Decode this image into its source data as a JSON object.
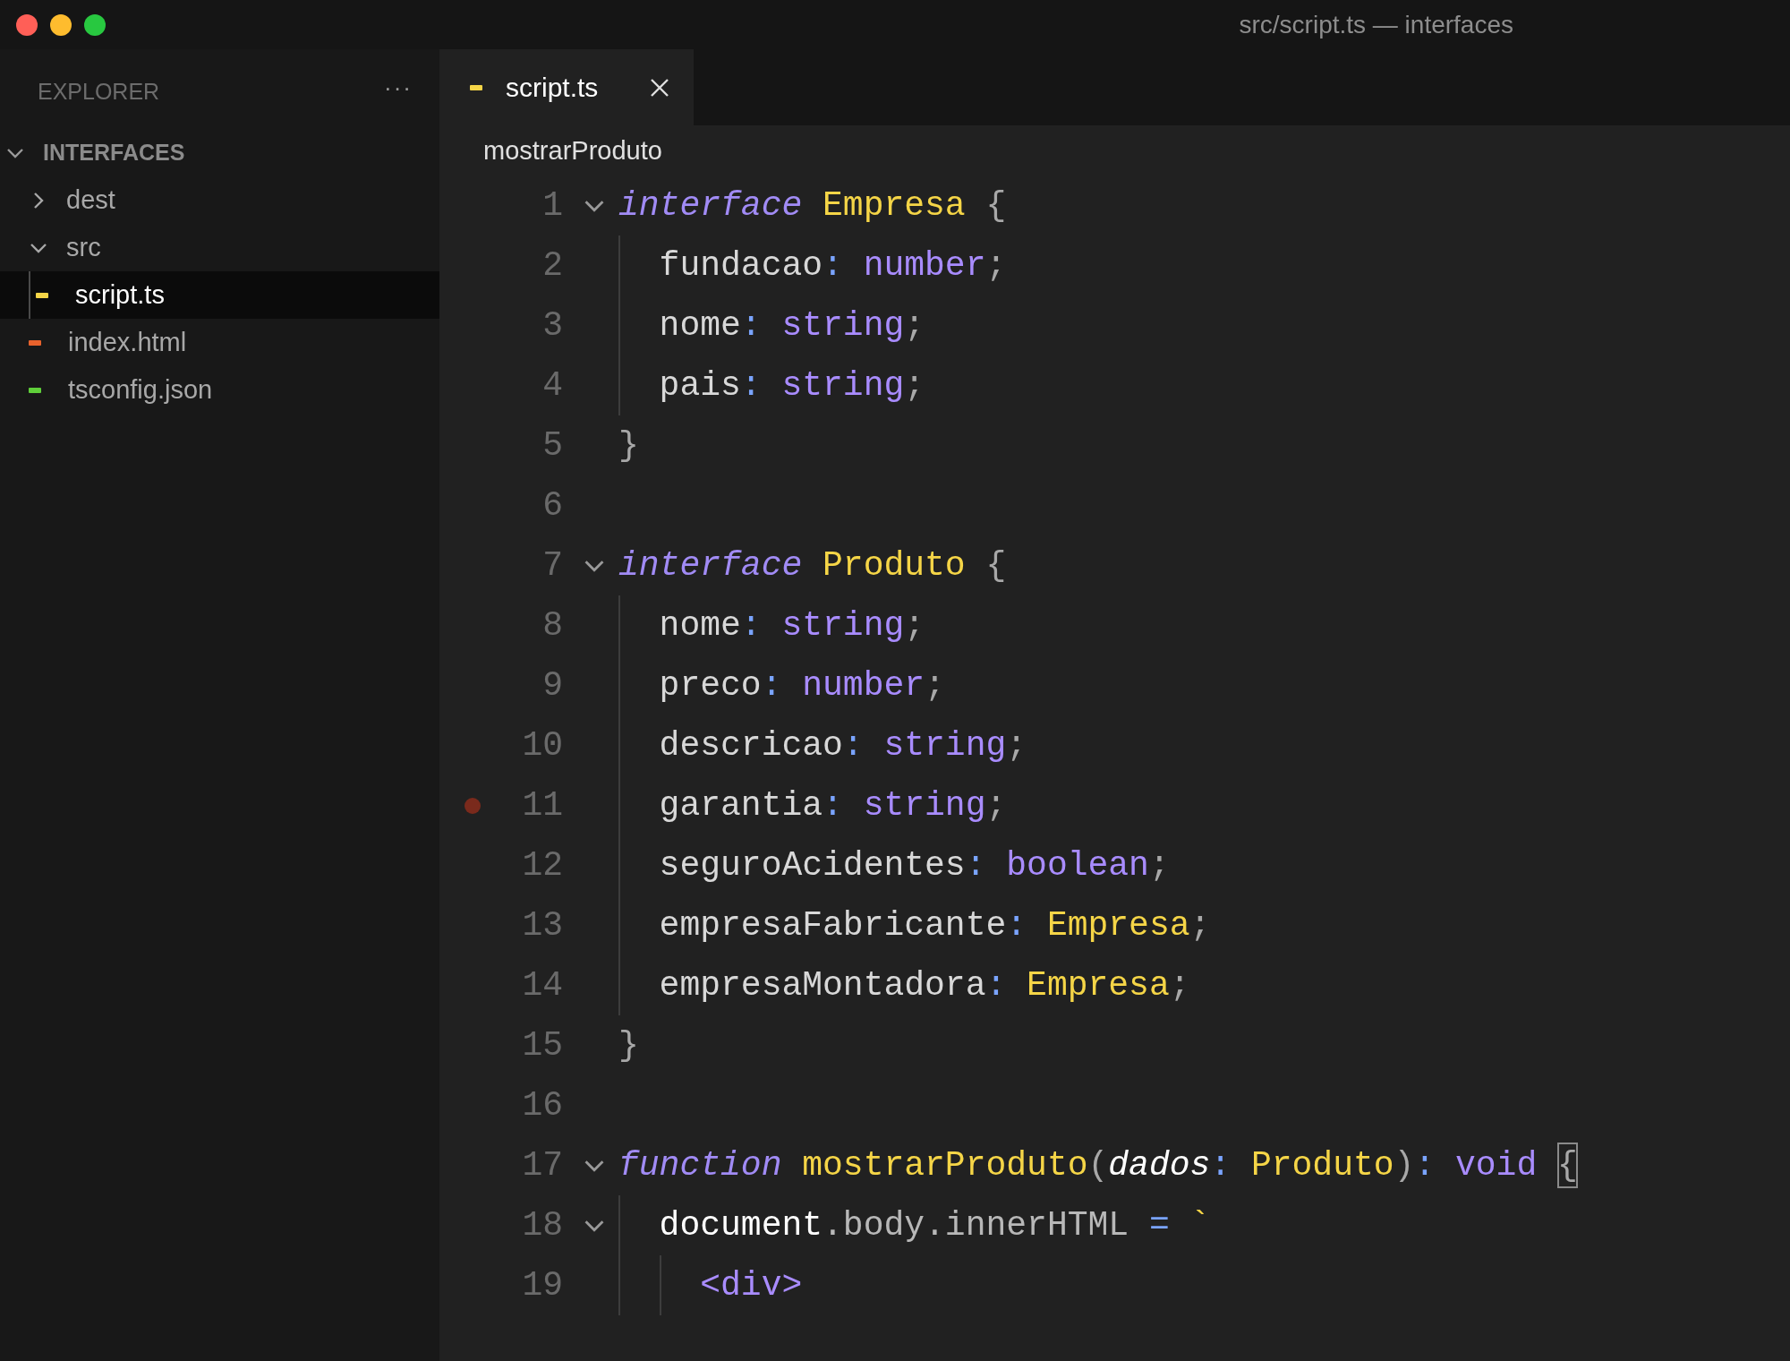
{
  "window": {
    "title": "src/script.ts — interfaces"
  },
  "sidebar": {
    "title": "EXPLORER",
    "more": "···",
    "tree": [
      {
        "label": "INTERFACES",
        "kind": "root",
        "expanded": true,
        "selected": false,
        "children": [
          {
            "label": "dest",
            "kind": "folder",
            "expanded": false,
            "selected": false
          },
          {
            "label": "src",
            "kind": "folder",
            "expanded": true,
            "selected": false,
            "children": [
              {
                "label": "script.ts",
                "kind": "file",
                "color": "#f5d547",
                "selected": true
              }
            ]
          },
          {
            "label": "index.html",
            "kind": "file",
            "color": "#e8622c",
            "selected": false
          },
          {
            "label": "tsconfig.json",
            "kind": "file",
            "color": "#5fcf3a",
            "selected": false
          }
        ]
      }
    ]
  },
  "tabs": [
    {
      "label": "script.ts",
      "color": "#f5d547",
      "selected": true
    }
  ],
  "breadcrumb": "mostrarProduto",
  "lines": [
    {
      "number": "1",
      "foldable": true,
      "breakpoint": false,
      "tokens": [
        {
          "kind": "keyword",
          "text": "interface "
        },
        {
          "kind": "type-name",
          "text": "Empresa "
        },
        {
          "kind": "brace",
          "text": "{"
        }
      ]
    },
    {
      "number": "2",
      "foldable": false,
      "breakpoint": false,
      "tokens": [
        {
          "kind": "plain",
          "text": "  fundacao"
        },
        {
          "kind": "punct",
          "text": ": "
        },
        {
          "kind": "type",
          "text": "number"
        },
        {
          "kind": "brace",
          "text": ";"
        }
      ]
    },
    {
      "number": "3",
      "foldable": false,
      "breakpoint": false,
      "tokens": [
        {
          "kind": "plain",
          "text": "  nome"
        },
        {
          "kind": "punct",
          "text": ": "
        },
        {
          "kind": "type",
          "text": "string"
        },
        {
          "kind": "brace",
          "text": ";"
        }
      ]
    },
    {
      "number": "4",
      "foldable": false,
      "breakpoint": false,
      "tokens": [
        {
          "kind": "plain",
          "text": "  pais"
        },
        {
          "kind": "punct",
          "text": ": "
        },
        {
          "kind": "type",
          "text": "string"
        },
        {
          "kind": "brace",
          "text": ";"
        }
      ]
    },
    {
      "number": "5",
      "foldable": false,
      "breakpoint": false,
      "tokens": [
        {
          "kind": "brace",
          "text": "}"
        }
      ]
    },
    {
      "number": "6",
      "foldable": false,
      "breakpoint": false
    },
    {
      "number": "7",
      "foldable": true,
      "breakpoint": false,
      "tokens": [
        {
          "kind": "keyword",
          "text": "interface "
        },
        {
          "kind": "type-name",
          "text": "Produto "
        },
        {
          "kind": "brace",
          "text": "{"
        }
      ]
    },
    {
      "number": "8",
      "foldable": false,
      "breakpoint": false,
      "tokens": [
        {
          "kind": "plain",
          "text": "  nome"
        },
        {
          "kind": "punct",
          "text": ": "
        },
        {
          "kind": "type",
          "text": "string"
        },
        {
          "kind": "brace",
          "text": ";"
        }
      ]
    },
    {
      "number": "9",
      "foldable": false,
      "breakpoint": false,
      "tokens": [
        {
          "kind": "plain",
          "text": "  preco"
        },
        {
          "kind": "punct",
          "text": ": "
        },
        {
          "kind": "type",
          "text": "number"
        },
        {
          "kind": "brace",
          "text": ";"
        }
      ]
    },
    {
      "number": "10",
      "foldable": false,
      "breakpoint": false,
      "tokens": [
        {
          "kind": "plain",
          "text": "  descricao"
        },
        {
          "kind": "punct",
          "text": ": "
        },
        {
          "kind": "type",
          "text": "string"
        },
        {
          "kind": "brace",
          "text": ";"
        }
      ]
    },
    {
      "number": "11",
      "foldable": false,
      "breakpoint": true,
      "tokens": [
        {
          "kind": "plain",
          "text": "  garantia"
        },
        {
          "kind": "punct",
          "text": ": "
        },
        {
          "kind": "type",
          "text": "string"
        },
        {
          "kind": "brace",
          "text": ";"
        }
      ]
    },
    {
      "number": "12",
      "foldable": false,
      "breakpoint": false,
      "tokens": [
        {
          "kind": "plain",
          "text": "  seguroAcidentes"
        },
        {
          "kind": "punct",
          "text": ": "
        },
        {
          "kind": "type",
          "text": "boolean"
        },
        {
          "kind": "brace",
          "text": ";"
        }
      ]
    },
    {
      "number": "13",
      "foldable": false,
      "breakpoint": false,
      "tokens": [
        {
          "kind": "plain",
          "text": "  empresaFabricante"
        },
        {
          "kind": "punct",
          "text": ": "
        },
        {
          "kind": "type-name",
          "text": "Empresa"
        },
        {
          "kind": "brace",
          "text": ";"
        }
      ]
    },
    {
      "number": "14",
      "foldable": false,
      "breakpoint": false,
      "tokens": [
        {
          "kind": "plain",
          "text": "  empresaMontadora"
        },
        {
          "kind": "punct",
          "text": ": "
        },
        {
          "kind": "type-name",
          "text": "Empresa"
        },
        {
          "kind": "brace",
          "text": ";"
        }
      ]
    },
    {
      "number": "15",
      "foldable": false,
      "breakpoint": false,
      "tokens": [
        {
          "kind": "brace",
          "text": "}"
        }
      ]
    },
    {
      "number": "16",
      "foldable": false,
      "breakpoint": false
    },
    {
      "number": "17",
      "foldable": true,
      "breakpoint": false,
      "tokens": [
        {
          "kind": "keyword",
          "text": "function "
        },
        {
          "kind": "type-name",
          "text": "mostrarProduto"
        },
        {
          "kind": "brace",
          "text": "("
        },
        {
          "kind": "param",
          "text": "dados"
        },
        {
          "kind": "punct",
          "text": ": "
        },
        {
          "kind": "type-name",
          "text": "Produto"
        },
        {
          "kind": "brace",
          "text": ")"
        },
        {
          "kind": "punct",
          "text": ": "
        },
        {
          "kind": "type",
          "text": "void "
        },
        {
          "kind": "matched-brace",
          "text": "{"
        }
      ]
    },
    {
      "number": "18",
      "foldable": true,
      "breakpoint": false,
      "tokens": [
        {
          "kind": "variable",
          "text": "  document"
        },
        {
          "kind": "member",
          "text": ".body.innerHTML "
        },
        {
          "kind": "punct",
          "text": "= "
        },
        {
          "kind": "string",
          "text": "`"
        }
      ]
    },
    {
      "number": "19",
      "foldable": false,
      "breakpoint": false,
      "tokens": [
        {
          "kind": "tag",
          "text": "    <div>"
        }
      ]
    }
  ]
}
